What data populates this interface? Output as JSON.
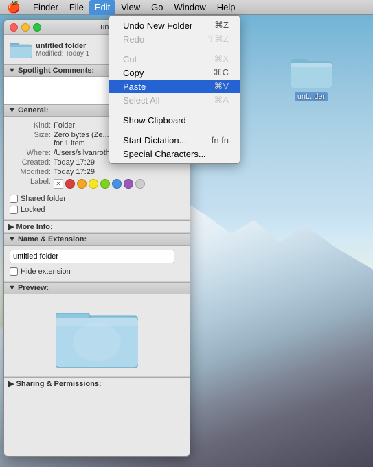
{
  "menubar": {
    "apple": "🍎",
    "items": [
      {
        "label": "Finder",
        "active": false
      },
      {
        "label": "File",
        "active": false
      },
      {
        "label": "Edit",
        "active": true
      },
      {
        "label": "View",
        "active": false
      },
      {
        "label": "Go",
        "active": false
      },
      {
        "label": "Window",
        "active": false
      },
      {
        "label": "Help",
        "active": false
      }
    ]
  },
  "finder_window": {
    "title": "untitled",
    "info": {
      "name": "untitled folder",
      "modified": "Modified: Today 1"
    },
    "spotlight_label": "▼ Spotlight Comments:",
    "general_label": "▼ General:",
    "properties": {
      "kind_label": "Kind:",
      "kind_value": "Folder",
      "size_label": "Size:",
      "size_value": "Zero bytes (Ze...",
      "size_sub": "for 1 item",
      "where_label": "Where:",
      "where_value": "/Users/silvanroth/Desktop",
      "created_label": "Created:",
      "created_value": "Today 17:29",
      "modified_label": "Modified:",
      "modified_value": "Today 17:29",
      "label_label": "Label:"
    },
    "checkboxes": {
      "shared_label": "Shared folder",
      "locked_label": "Locked"
    },
    "more_info_label": "▶ More Info:",
    "name_ext_label": "▼ Name & Extension:",
    "name_value": "untitled folder",
    "hide_ext_label": "Hide extension",
    "preview_label": "▼ Preview:",
    "sharing_label": "▶ Sharing & Permissions:"
  },
  "edit_menu": {
    "items": [
      {
        "label": "Undo New Folder",
        "shortcut": "⌘Z",
        "disabled": false,
        "highlighted": false,
        "separator_after": false
      },
      {
        "label": "Redo",
        "shortcut": "⇧⌘Z",
        "disabled": true,
        "highlighted": false,
        "separator_after": true
      },
      {
        "label": "Cut",
        "shortcut": "⌘X",
        "disabled": true,
        "highlighted": false,
        "separator_after": false
      },
      {
        "label": "Copy",
        "shortcut": "⌘C",
        "disabled": false,
        "highlighted": false,
        "separator_after": false
      },
      {
        "label": "Paste",
        "shortcut": "⌘V",
        "disabled": false,
        "highlighted": true,
        "separator_after": false
      },
      {
        "label": "Select All",
        "shortcut": "⌘A",
        "disabled": true,
        "highlighted": false,
        "separator_after": true
      },
      {
        "label": "Show Clipboard",
        "shortcut": "",
        "disabled": false,
        "highlighted": false,
        "separator_after": true
      },
      {
        "label": "Start Dictation...",
        "shortcut": "fn fn",
        "disabled": false,
        "highlighted": false,
        "separator_after": false
      },
      {
        "label": "Special Characters...",
        "shortcut": "",
        "disabled": false,
        "highlighted": false,
        "separator_after": false
      }
    ]
  },
  "desktop_folder": {
    "label": "unt...der"
  },
  "label_colors": [
    {
      "color": "#d94040"
    },
    {
      "color": "#f5a623"
    },
    {
      "color": "#f8e71c"
    },
    {
      "color": "#7ed321"
    },
    {
      "color": "#4a90e2"
    },
    {
      "color": "#9b59b6"
    },
    {
      "color": "#cccccc"
    }
  ]
}
